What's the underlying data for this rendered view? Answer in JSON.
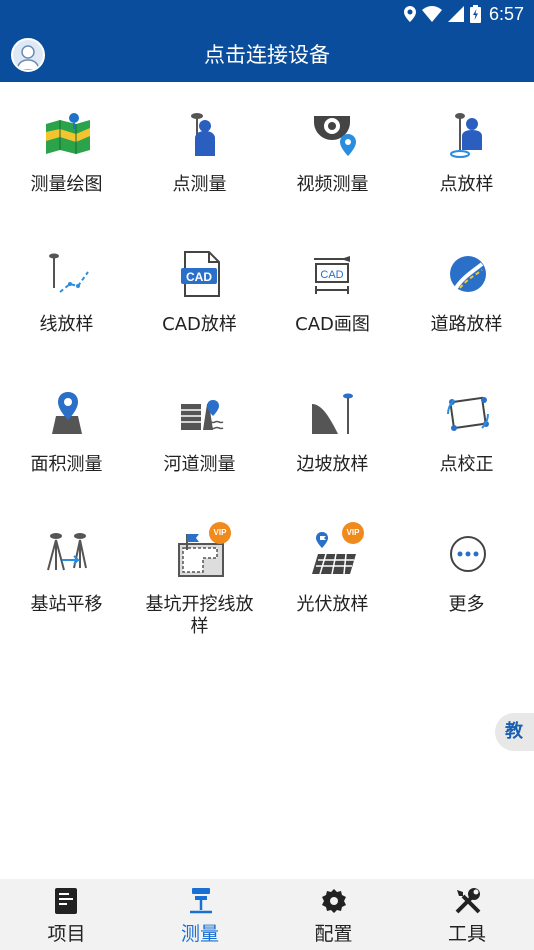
{
  "status_bar": {
    "time": "6:57"
  },
  "app_bar": {
    "title": "点击连接设备"
  },
  "tiles": [
    {
      "label": "测量绘图",
      "icon": "map-survey-icon",
      "vip": false
    },
    {
      "label": "点测量",
      "icon": "surveyor-point-icon",
      "vip": false
    },
    {
      "label": "视频测量",
      "icon": "camera-location-icon",
      "vip": false
    },
    {
      "label": "点放样",
      "icon": "point-stakeout-icon",
      "vip": false
    },
    {
      "label": "线放样",
      "icon": "line-stakeout-icon",
      "vip": false
    },
    {
      "label": "CAD放样",
      "icon": "cad-file-icon",
      "vip": false
    },
    {
      "label": "CAD画图",
      "icon": "cad-drawing-icon",
      "vip": false
    },
    {
      "label": "道路放样",
      "icon": "road-icon",
      "vip": false
    },
    {
      "label": "面积测量",
      "icon": "area-measure-icon",
      "vip": false
    },
    {
      "label": "河道测量",
      "icon": "river-survey-icon",
      "vip": false
    },
    {
      "label": "边坡放样",
      "icon": "slope-stakeout-icon",
      "vip": false
    },
    {
      "label": "点校正",
      "icon": "point-calibration-icon",
      "vip": false
    },
    {
      "label": "基站平移",
      "icon": "base-station-shift-icon",
      "vip": false
    },
    {
      "label": "基坑开挖线放样",
      "icon": "foundation-pit-icon",
      "vip": true
    },
    {
      "label": "光伏放样",
      "icon": "solar-panel-icon",
      "vip": true
    },
    {
      "label": "更多",
      "icon": "more-icon",
      "vip": false
    }
  ],
  "vip_text": "VIP",
  "side_tab": {
    "label": "教"
  },
  "bottom_nav": [
    {
      "label": "项目",
      "icon": "project-icon",
      "active": false
    },
    {
      "label": "测量",
      "icon": "survey-icon",
      "active": true
    },
    {
      "label": "配置",
      "icon": "settings-gear-icon",
      "active": false
    },
    {
      "label": "工具",
      "icon": "tools-icon",
      "active": false
    }
  ],
  "colors": {
    "primary": "#0a4d9c",
    "accent": "#1a6fd4",
    "vip": "#f08a1c",
    "nav_bg": "#f2f2f2"
  }
}
